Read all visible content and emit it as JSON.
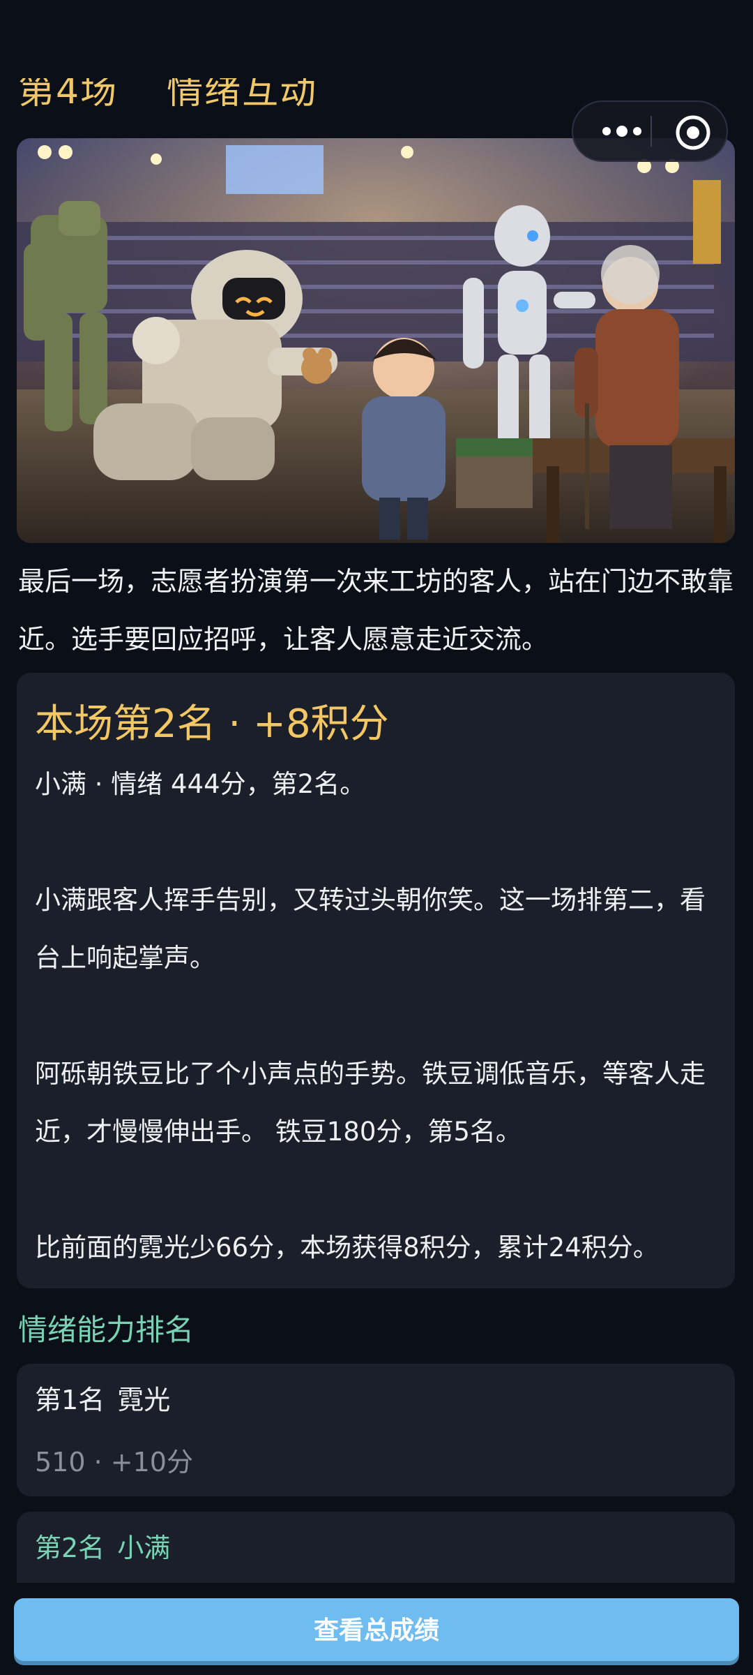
{
  "header": {
    "heading_partial_left": "第4场",
    "heading_partial_right": "情绪互动"
  },
  "hero_image": {
    "alt": "机器人与孩子和老人在竞技场中互动"
  },
  "intro_text": "最后一场，志愿者扮演第一次来工坊的客人，站在门边不敢靠近。选手要回应招呼，让客人愿意走近交流。",
  "result": {
    "title": "本场第2名 · +8积分",
    "summary": "小满 · 情绪 444分，第2名。",
    "paragraph1": "小满跟客人挥手告别，又转过头朝你笑。这一场排第二，看台上响起掌声。",
    "paragraph2": "阿砾朝铁豆比了个小声点的手势。铁豆调低音乐，等客人走近，才慢慢伸出手。 铁豆180分，第5名。",
    "paragraph3": "比前面的霓光少66分，本场获得8积分，累计24积分。"
  },
  "ranking": {
    "title": "情绪能力排名",
    "items": [
      {
        "place": "第1名",
        "name": "霓光",
        "score": "510 · +10分"
      },
      {
        "place": "第2名",
        "name": "小满"
      }
    ]
  },
  "footer": {
    "button_label": "查看总成绩"
  },
  "colors": {
    "accent_gold": "#f4c765",
    "accent_teal": "#79d4b6",
    "button_blue": "#6ebcf0",
    "card_bg": "#1a1f29",
    "page_bg": "#0b0f17"
  }
}
